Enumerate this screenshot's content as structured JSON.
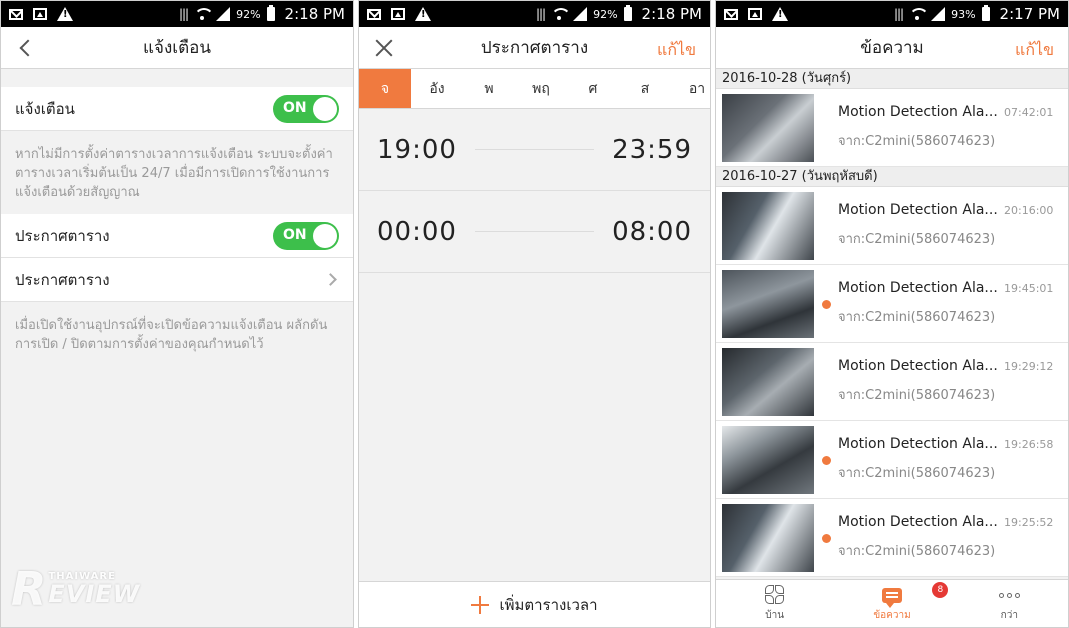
{
  "statusbar": {
    "p1": {
      "battery": "92%",
      "time": "2:18 PM"
    },
    "p2": {
      "battery": "92%",
      "time": "2:18 PM"
    },
    "p3": {
      "battery": "93%",
      "time": "2:17 PM"
    }
  },
  "panel1": {
    "title": "แจ้งเตือน",
    "alert_label": "แจ้งเตือน",
    "alert_toggle": "ON",
    "alert_note": "หากไม่มีการตั้งค่าตารางเวลาการแจ้งเตือน ระบบจะตั้งค่าตารางเวลาเริ่มต้นเป็น 24/7 เมื่อมีการเปิดการใช้งานการแจ้งเตือนด้วยสัญญาณ",
    "schedule_label": "ประกาศตาราง",
    "schedule_toggle": "ON",
    "schedule_link": "ประกาศตาราง",
    "schedule_note": "เมื่อเปิดใช้งานอุปกรณ์ที่จะเปิดข้อความแจ้งเตือน ผลักดันการเปิด / ปิดตามการตั้งค่าของคุณกำหนดไว้",
    "watermark_top": "THAIWARE",
    "watermark_bottom": "EVIEW",
    "watermark_r": "R"
  },
  "panel2": {
    "title": "ประกาศตาราง",
    "edit": "แก้ไข",
    "days": [
      "จ",
      "อัง",
      "พ",
      "พฤ",
      "ศ",
      "ส",
      "อา"
    ],
    "active_day": 0,
    "slots": [
      {
        "start": "19:00",
        "end": "23:59"
      },
      {
        "start": "00:00",
        "end": "08:00"
      }
    ],
    "add_label": "เพิ่มตารางเวลา"
  },
  "panel3": {
    "title": "ข้อความ",
    "edit": "แก้ไข",
    "groups": [
      {
        "date": "2016-10-28 (วันศุกร์)",
        "items": [
          {
            "title": "Motion Detection Ala...",
            "time": "07:42:01",
            "from": "จาก:C2mini(586074623)",
            "unread": false
          }
        ]
      },
      {
        "date": "2016-10-27 (วันพฤหัสบดี)",
        "items": [
          {
            "title": "Motion Detection Ala...",
            "time": "20:16:00",
            "from": "จาก:C2mini(586074623)",
            "unread": false
          },
          {
            "title": "Motion Detection Ala...",
            "time": "19:45:01",
            "from": "จาก:C2mini(586074623)",
            "unread": true
          },
          {
            "title": "Motion Detection Ala...",
            "time": "19:29:12",
            "from": "จาก:C2mini(586074623)",
            "unread": false
          },
          {
            "title": "Motion Detection Ala...",
            "time": "19:26:58",
            "from": "จาก:C2mini(586074623)",
            "unread": true
          },
          {
            "title": "Motion Detection Ala...",
            "time": "19:25:52",
            "from": "จาก:C2mini(586074623)",
            "unread": true
          }
        ]
      }
    ],
    "tabs": [
      {
        "label": "บ้าน",
        "icon": "fan-icon"
      },
      {
        "label": "ข้อความ",
        "icon": "chat-icon",
        "badge": "8"
      },
      {
        "label": "กว่า",
        "icon": "more-icon"
      }
    ]
  },
  "colors": {
    "accent": "#f07a3f",
    "toggle": "#3dbf4b",
    "badge": "#e53935"
  }
}
